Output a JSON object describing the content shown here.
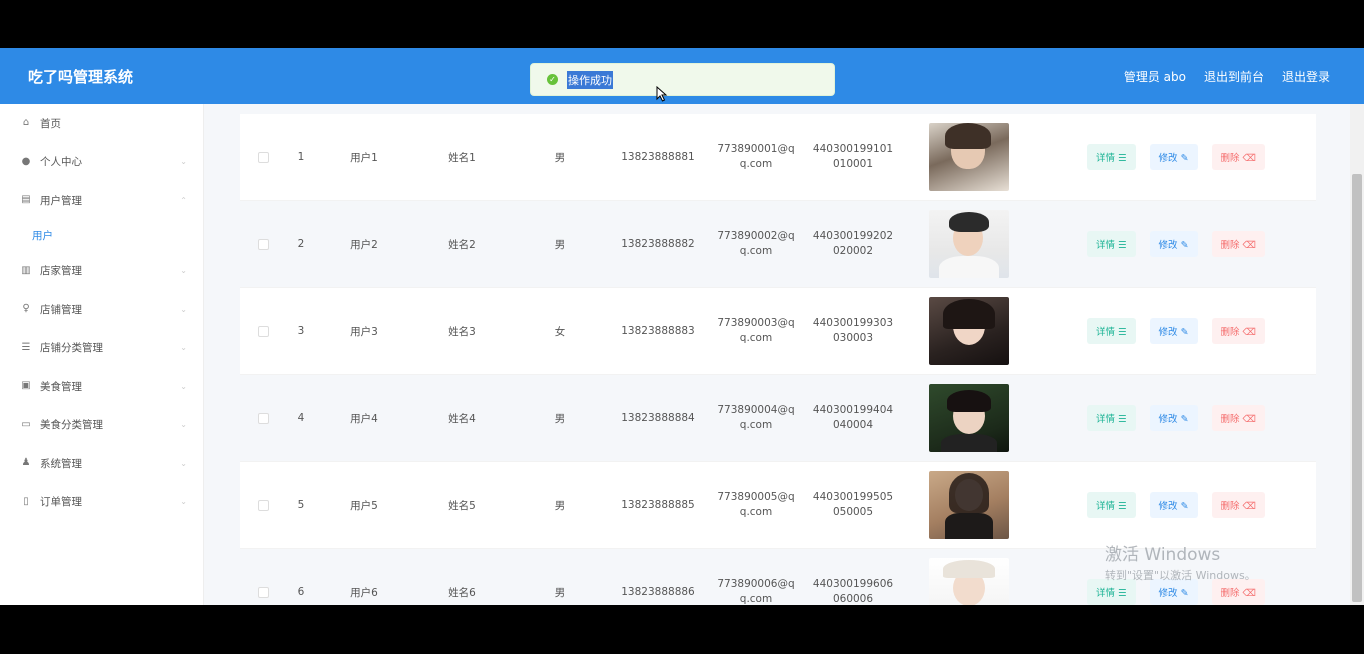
{
  "header": {
    "title": "吃了吗管理系统",
    "admin_label": "管理员 abo",
    "back_label": "退出到前台",
    "logout_label": "退出登录",
    "color": "#2e8ae6"
  },
  "toast": {
    "message": "操作成功",
    "icon": "check-circle-icon",
    "color": "#67c23a"
  },
  "sidebar": {
    "items": [
      {
        "label": "首页",
        "icon": "home-icon"
      },
      {
        "label": "个人中心",
        "icon": "user-icon"
      },
      {
        "label": "用户管理",
        "icon": "users-icon"
      },
      {
        "label": "店家管理",
        "icon": "bar-chart-icon"
      },
      {
        "label": "店铺管理",
        "icon": "shop-icon"
      },
      {
        "label": "店铺分类管理",
        "icon": "list-icon"
      },
      {
        "label": "美食管理",
        "icon": "food-icon"
      },
      {
        "label": "美食分类管理",
        "icon": "category-icon"
      },
      {
        "label": "系统管理",
        "icon": "settings-icon"
      },
      {
        "label": "订单管理",
        "icon": "order-icon"
      }
    ],
    "sub_item": "用户"
  },
  "table": {
    "buttons": {
      "detail": "详情 ☰",
      "edit": "修改 ✎",
      "delete": "删除 ⌫"
    },
    "rows": [
      {
        "idx": "1",
        "account": "用户1",
        "name": "姓名1",
        "sex": "男",
        "phone": "13823888881",
        "email": "773890001@qq.com",
        "idcard": "440300199101010001"
      },
      {
        "idx": "2",
        "account": "用户2",
        "name": "姓名2",
        "sex": "男",
        "phone": "13823888882",
        "email": "773890002@qq.com",
        "idcard": "440300199202020002"
      },
      {
        "idx": "3",
        "account": "用户3",
        "name": "姓名3",
        "sex": "女",
        "phone": "13823888883",
        "email": "773890003@qq.com",
        "idcard": "440300199303030003"
      },
      {
        "idx": "4",
        "account": "用户4",
        "name": "姓名4",
        "sex": "男",
        "phone": "13823888884",
        "email": "773890004@qq.com",
        "idcard": "440300199404040004"
      },
      {
        "idx": "5",
        "account": "用户5",
        "name": "姓名5",
        "sex": "男",
        "phone": "13823888885",
        "email": "773890005@qq.com",
        "idcard": "440300199505050005"
      },
      {
        "idx": "6",
        "account": "用户6",
        "name": "姓名6",
        "sex": "男",
        "phone": "13823888886",
        "email": "773890006@qq.com",
        "idcard": "440300199606060006"
      }
    ]
  },
  "watermark": {
    "line1": "激活 Windows",
    "line2": "转到\"设置\"以激活 Windows。"
  }
}
